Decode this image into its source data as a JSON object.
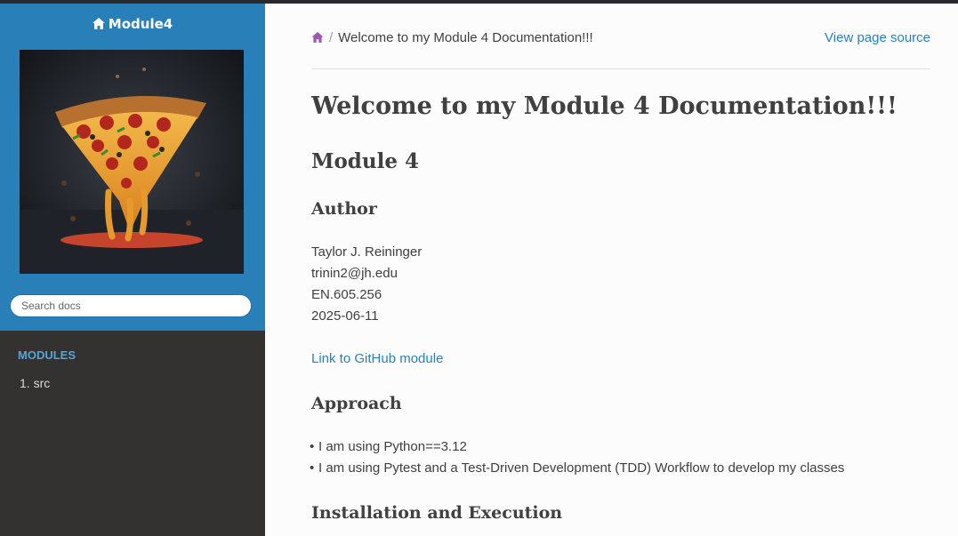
{
  "sidebar": {
    "brand": "Module4",
    "search_placeholder": "Search docs",
    "caption": "MODULES",
    "items": [
      {
        "label": "1. src"
      }
    ]
  },
  "breadcrumb": {
    "current": "Welcome to my Module 4 Documentation!!!",
    "view_source": "View page source"
  },
  "content": {
    "title": "Welcome to my Module 4 Documentation!!!",
    "module_heading": "Module 4",
    "author_heading": "Author",
    "author_lines": [
      "Taylor J. Reininger",
      "trinin2@jh.edu",
      "EN.605.256",
      "2025-06-11"
    ],
    "github_link": "Link to GitHub module",
    "approach_heading": "Approach",
    "approach_items": [
      "I am using Python==3.12",
      "I am using Pytest and a Test-Driven Development (TDD) Workflow to develop my classes"
    ],
    "install_heading": "Installation and Execution"
  },
  "colors": {
    "sidebar_accent": "#2980b9",
    "sidebar_dark": "#343131",
    "link": "#2980b9",
    "caption": "#55a5d9"
  }
}
